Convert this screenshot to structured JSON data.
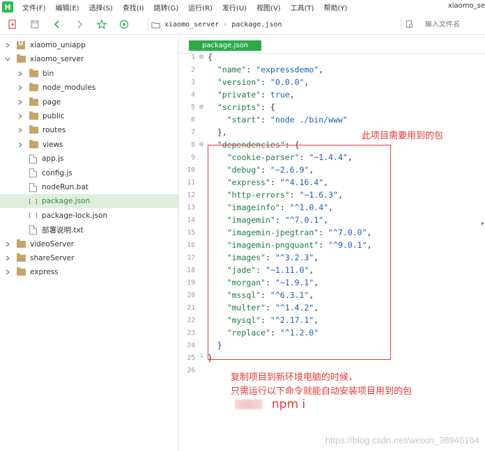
{
  "window": {
    "title": "xiaomo_se"
  },
  "menu": [
    "文件(F)",
    "编辑(E)",
    "选择(S)",
    "查找(I)",
    "跳转(G)",
    "运行(R)",
    "发行(U)",
    "视图(V)",
    "工具(T)",
    "帮助(Y)"
  ],
  "toolbar": {
    "icons": [
      "new-file-icon",
      "save-icon",
      "back-icon",
      "forward-icon",
      "star-icon",
      "run-icon"
    ],
    "path": [
      "xiaomo_server",
      "package.json"
    ],
    "search_placeholder": "输入文件名"
  },
  "sidebar": {
    "items": [
      {
        "label": "xiaomo_uniapp",
        "type": "project",
        "depth": 0,
        "expanded": false
      },
      {
        "label": "xiaomo_server",
        "type": "folder",
        "depth": 0,
        "expanded": true
      },
      {
        "label": "bin",
        "type": "folder",
        "depth": 1,
        "expanded": false
      },
      {
        "label": "node_modules",
        "type": "folder",
        "depth": 1,
        "expanded": false
      },
      {
        "label": "page",
        "type": "folder",
        "depth": 1,
        "expanded": false
      },
      {
        "label": "public",
        "type": "folder",
        "depth": 1,
        "expanded": false
      },
      {
        "label": "routes",
        "type": "folder",
        "depth": 1,
        "expanded": false
      },
      {
        "label": "views",
        "type": "folder",
        "depth": 1,
        "expanded": false
      },
      {
        "label": "app.js",
        "type": "file",
        "depth": 1
      },
      {
        "label": "config.js",
        "type": "file",
        "depth": 1
      },
      {
        "label": "nodeRun.bat",
        "type": "file",
        "depth": 1
      },
      {
        "label": "package.json",
        "type": "json",
        "depth": 1,
        "selected": true
      },
      {
        "label": "package-lock.json",
        "type": "json",
        "depth": 1
      },
      {
        "label": "部署说明.txt",
        "type": "file",
        "depth": 1
      },
      {
        "label": "videoServer",
        "type": "folder",
        "depth": 0,
        "expanded": false
      },
      {
        "label": "shareServer",
        "type": "folder",
        "depth": 0,
        "expanded": false
      },
      {
        "label": "express",
        "type": "folder",
        "depth": 0,
        "expanded": false
      }
    ]
  },
  "editor": {
    "tab": "package.json",
    "lines": [
      {
        "n": "1",
        "fold": "⊟",
        "text": "{"
      },
      {
        "n": "2",
        "text": "  \"name\": \"expressdemo\","
      },
      {
        "n": "3",
        "text": "  \"version\": \"0.0.0\","
      },
      {
        "n": "4",
        "text": "  \"private\": true,"
      },
      {
        "n": "5",
        "fold": "⊟",
        "text": "  \"scripts\": {"
      },
      {
        "n": "6",
        "text": "    \"start\": \"node ./bin/www\""
      },
      {
        "n": "7",
        "text": "  },"
      },
      {
        "n": "8",
        "fold": "⊟",
        "text": "  \"dependencies\": {"
      },
      {
        "n": "9",
        "text": "    \"cookie-parser\": \"~1.4.4\","
      },
      {
        "n": "10",
        "text": "    \"debug\": \"~2.6.9\","
      },
      {
        "n": "11",
        "text": "    \"express\": \"^4.16.4\","
      },
      {
        "n": "12",
        "text": "    \"http-errors\": \"~1.6.3\","
      },
      {
        "n": "13",
        "text": "    \"imageinfo\": \"^1.0.4\","
      },
      {
        "n": "14",
        "text": "    \"imagemin\": \"^7.0.1\","
      },
      {
        "n": "15",
        "text": "    \"imagemin-jpegtran\": \"^7.0.0\","
      },
      {
        "n": "16",
        "text": "    \"imagemin-pngquant\": \"^9.0.1\","
      },
      {
        "n": "17",
        "text": "    \"images\": \"^3.2.3\","
      },
      {
        "n": "18",
        "text": "    \"jade\": \"~1.11.0\","
      },
      {
        "n": "19",
        "text": "    \"morgan\": \"~1.9.1\","
      },
      {
        "n": "20",
        "text": "    \"mssql\": \"^6.3.1\","
      },
      {
        "n": "21",
        "text": "    \"multer\": \"^1.4.2\","
      },
      {
        "n": "22",
        "text": "    \"mysql\": \"^2.17.1\","
      },
      {
        "n": "23",
        "text": "    \"replace\": \"^1.2.0\""
      },
      {
        "n": "24",
        "text": "  }"
      },
      {
        "n": "25",
        "fold": "└",
        "text": "}"
      },
      {
        "n": "26",
        "text": ""
      }
    ]
  },
  "annotations": {
    "box_label": "此项目需要用到的包",
    "note_line1": "复制项目到新环境电脑的时候，",
    "note_line2": "只需运行以下命令就能自动安装项目用到的包",
    "command": "npm i",
    "color": "#e53935"
  },
  "watermark": "https://blog.csdn.net/weixin_38946164",
  "colors": {
    "accent": "#2eaa4d",
    "selected_bg": "#dfeedd",
    "key": "#1e7b45",
    "string": "#1a5fb4"
  }
}
